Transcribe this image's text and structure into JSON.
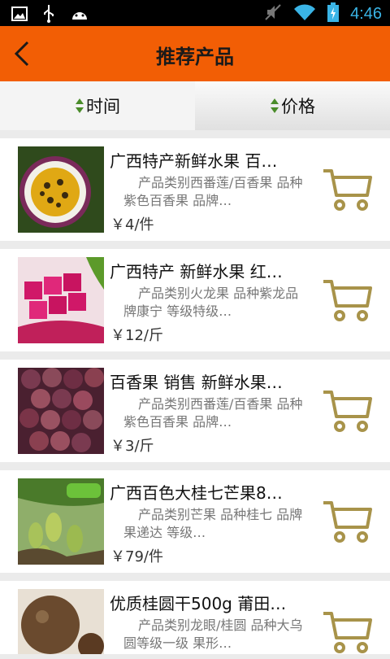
{
  "status_bar": {
    "time": "4:46",
    "icons": [
      "image-icon",
      "usb-icon",
      "android-icon",
      "mute-icon",
      "wifi-icon",
      "battery-charging-icon"
    ]
  },
  "header": {
    "title": "推荐产品",
    "back_icon": "chevron-left-icon"
  },
  "sort_tabs": [
    {
      "label": "时间",
      "icon": "sort-arrows-icon"
    },
    {
      "label": "价格",
      "icon": "sort-arrows-icon"
    }
  ],
  "colors": {
    "header": "#f25e05",
    "cart": "#a8934a",
    "sort_arrow": "#4a8c2a"
  },
  "products": [
    {
      "name": "广西特产新鲜水果 百…",
      "desc": "产品类别西番莲/百香果 品种紫色百香果 品牌…",
      "price": "￥4/件",
      "image": "passion-fruit-cut"
    },
    {
      "name": "广西特产 新鲜水果 红…",
      "desc": "产品类别火龙果 品种紫龙品牌康宁 等级特级…",
      "price": "￥12/斤",
      "image": "dragon-fruit-cubes"
    },
    {
      "name": "百香果 销售 新鲜水果…",
      "desc": "产品类别西番莲/百香果 品种紫色百香果 品牌…",
      "price": "￥3/斤",
      "image": "passion-fruit-pile"
    },
    {
      "name": "广西百色大桂七芒果8…",
      "desc": "产品类别芒果 品种桂七 品牌果递达 等级…",
      "price": "￥79/件",
      "image": "mango-tree"
    },
    {
      "name": "优质桂圆干500g 莆田…",
      "desc": "产品类别龙眼/桂圆 品种大乌圆等级一级 果形…",
      "price": "",
      "image": "dried-longan"
    }
  ]
}
